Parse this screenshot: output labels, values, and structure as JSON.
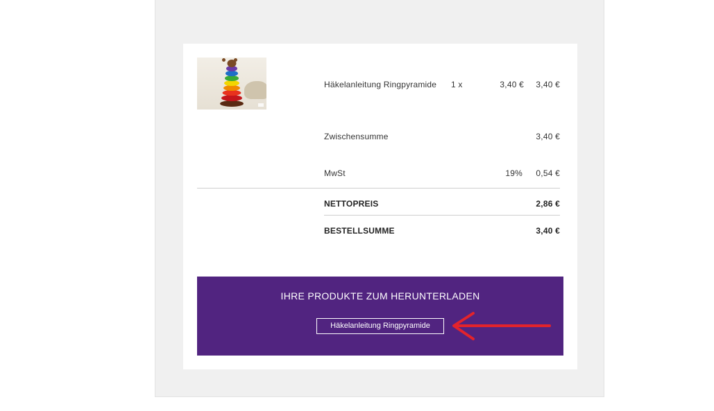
{
  "order": {
    "item": {
      "name": "Häkelanleitung Ringpyramide",
      "quantity": "1 x",
      "unit_price": "3,40 €",
      "total": "3,40 €"
    },
    "subtotal": {
      "label": "Zwischensumme",
      "value": "3,40 €"
    },
    "tax": {
      "label": "MwSt",
      "rate": "19%",
      "value": "0,54 €"
    },
    "net": {
      "label": "NETTOPREIS",
      "value": "2,86 €"
    },
    "grand_total": {
      "label": "BESTELLSUMME",
      "value": "3,40 €"
    }
  },
  "downloads": {
    "title": "IHRE PRODUKTE ZUM HERUNTERLADEN",
    "link_label": "Häkelanleitung Ringpyramide"
  },
  "colors": {
    "download_panel": "#512480",
    "annotation_arrow": "#e3232b"
  }
}
